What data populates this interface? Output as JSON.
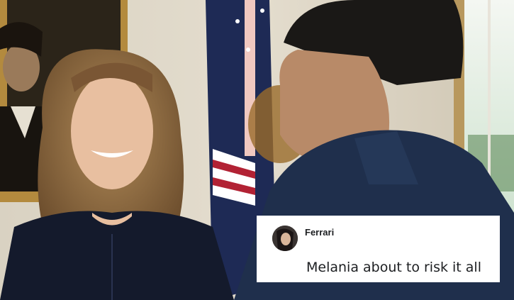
{
  "scene": {
    "description_icons": [
      "portrait-painting",
      "us-flag",
      "presidential-flag",
      "window",
      "woman-smiling",
      "man-profile"
    ]
  },
  "comment_card": {
    "username": "Ferrari",
    "text": "Melania about to risk it all",
    "avatar_icon": "user-avatar-icon"
  },
  "colors": {
    "card_bg": "#ffffff",
    "text": "#1c1e21"
  }
}
